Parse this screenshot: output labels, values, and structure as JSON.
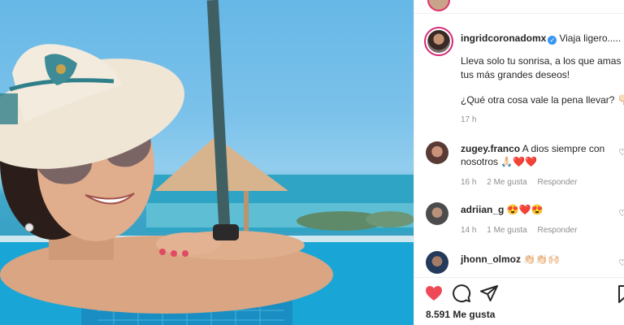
{
  "post": {
    "username": "ingridcoronadomx",
    "caption_title": "Viaja ligero.....",
    "caption_line1": "Lleva solo tu sonrisa, a los que amas y",
    "caption_line2": "tus más grandes deseos!",
    "caption_line3": "¿Qué otra cosa vale la pena llevar? 👇🏻",
    "time": "17 h",
    "likes": "8.591 Me gusta"
  },
  "comments": [
    {
      "username": "zugey.franco",
      "text_line1": "A dios siempre con",
      "text_line2": "nosotros 🙏🏻❤️❤️",
      "time": "16 h",
      "likes": "2 Me gusta",
      "reply": "Responder"
    },
    {
      "username": "adriian_g",
      "text_line1": "😍❤️😍",
      "time": "14 h",
      "likes": "1 Me gusta",
      "reply": "Responder"
    },
    {
      "username": "jhonn_olmoz",
      "text_line1": "👏🏻👏🏻🙌🏻"
    }
  ],
  "icons": {
    "like": "heart-filled-icon",
    "comment": "comment-bubble-icon",
    "share": "paper-plane-icon",
    "save": "bookmark-icon",
    "verified": "verified-badge-icon",
    "comment_like": "small-heart-icon"
  },
  "colors": {
    "like_red": "#ed4956",
    "verified_blue": "#3897f0",
    "muted_text": "#8e8e8e",
    "story_ring": "#d62976"
  }
}
